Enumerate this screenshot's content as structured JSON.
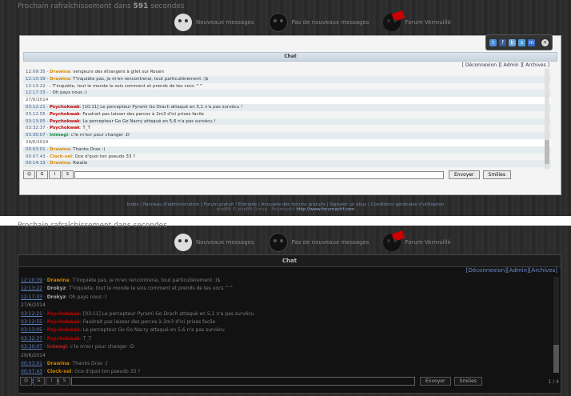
{
  "top": {
    "refresh": {
      "text": "Prochain rafraîchissement dans",
      "seconds": "591",
      "suffix": "secondes"
    },
    "legend": [
      {
        "icon": "white-skull",
        "label": "Nouveaux messages"
      },
      {
        "icon": "dark-skull",
        "label": "Pas de nouveaux messages"
      },
      {
        "icon": "locked-skull",
        "label": "Forum Verrouillé"
      }
    ],
    "chat": {
      "title": "Chat",
      "links": "[ Déconnexion ][ Admin ][ Archives ]",
      "messages": [
        {
          "time": "12:09:35",
          "user": "Drawina",
          "user_color": "#d98a00",
          "text": ": vengeurs des étrangers à gilet sur Rouen"
        },
        {
          "time": "12:10:39",
          "user": "Drawina",
          "user_color": "#d98a00",
          "text": ": T'inquiète pas, je m'en rencontrerai, tout particulièrement :)$"
        },
        {
          "time": "12:13:22",
          "user": "",
          "user_color": "#333",
          "text": ": T'inquiète, tout le monde le sois comment et prends de tes vocs ^^"
        },
        {
          "time": "12:17:33",
          "user": "",
          "user_color": "#333",
          "text": ": Oh pays nous :)"
        },
        {
          "date": "27/6/2014"
        },
        {
          "time": "03:12:21",
          "user": "Psychokwak",
          "user_color": "#b00",
          "text": ": [10:11] Le percepteur Pyrami Go Drach attaqué en 5,1 n'a pas survécu !"
        },
        {
          "time": "03:12:55",
          "user": "Psychokwak",
          "user_color": "#b00",
          "text": ": Faudrait pas laisser des percos à 2m3 d'ici prises facile"
        },
        {
          "time": "03:13:05",
          "user": "Psychokwak",
          "user_color": "#b00",
          "text": ": Le percepteur Go Go Nacry attaqué en 5,6 n'a pas survécu !"
        },
        {
          "time": "03:32:37",
          "user": "Psychokwak",
          "user_color": "#b00",
          "text": ": T_T"
        },
        {
          "time": "03:30:07",
          "user": "Inimegi",
          "user_color": "#1a8c3a",
          "text": ": c'le m'ecr pour changer :D"
        },
        {
          "date": "29/6/2014"
        },
        {
          "time": "00:03:01",
          "user": "Drawina",
          "user_color": "#d98a00",
          "text": ": Thanks Drax :)"
        },
        {
          "time": "00:07:43",
          "user": "Clock-xel",
          "user_color": "#d98a00",
          "text": ": Oce d'quoi ton pseudo 33 ?"
        },
        {
          "time": "00:14:19",
          "user": "Drawina",
          "user_color": "#d98a00",
          "text": ": Rwaile"
        }
      ],
      "send": "Envoyer",
      "smilies": "Smilies",
      "tools": [
        "☺",
        "G",
        "I",
        "S"
      ]
    },
    "footer": {
      "line1": "Index | Panneau d'administration | Forum gratuit ! Entraide | Annuaire des forums gratuits | Signaler un abus | Conditions générales d'utilisation",
      "line2": "phpBB © phpBB Group · Forumactif",
      "link": "http://www.forumactif.com"
    }
  },
  "bottom": {
    "refresh": {
      "text": "Prochain rafraîchissement dans",
      "seconds": "",
      "suffix": "secondes"
    },
    "legend": [
      {
        "icon": "white-skull",
        "label": "Nouveaux messages"
      },
      {
        "icon": "dark-skull",
        "label": "Pas de nouveaux messages"
      },
      {
        "icon": "locked-skull",
        "label": "Forum Verrouillé"
      }
    ],
    "chat": {
      "title": "Chat",
      "links": "[Déconnexion][Admin][Archives]",
      "messages": [
        {
          "time": "12:10:39",
          "user": "Drawina",
          "user_color": "#c88400",
          "text": ": T'inquiète pas, je m'en rencontrerai, tout particulièrement :)$"
        },
        {
          "time": "12:13:22",
          "user": "Drokyz",
          "user_color": "#aaa",
          "text": ": T'inquiète, tout le monde le sois comment et prends de tes vocs ^^"
        },
        {
          "time": "12:17:33",
          "user": "Drokyz",
          "user_color": "#aaa",
          "text": ": Oh pays nous :)"
        },
        {
          "date": "27/6/2014"
        },
        {
          "time": "03:12:21",
          "user": "Psychokwak",
          "user_color": "#b00",
          "text": ": [03:11] Le percepteur Pyrami Go Drach attaqué en 5,1 n'a pas survécu"
        },
        {
          "time": "03:12:55",
          "user": "Psychokwak",
          "user_color": "#b00",
          "text": ": Faudrait pas laisser des percos à 2m3 d'ici prises facile"
        },
        {
          "time": "03:13:05",
          "user": "Psychokwak",
          "user_color": "#b00",
          "text": ": Le percepteur Go Go Nacry attaqué en 5,6 n'a pas survécu"
        },
        {
          "time": "03:32:37",
          "user": "Psychokwak",
          "user_color": "#b00",
          "text": ": T_T"
        },
        {
          "time": "03:30:07",
          "user": "Inimegi",
          "user_color": "#b02020",
          "text": ": c'le m'ecr pour changer :D"
        },
        {
          "date": "29/6/2014"
        },
        {
          "time": "00:03:01",
          "user": "Drawina",
          "user_color": "#c88400",
          "text": ": Thanks Drax :)"
        },
        {
          "time": "00:07:43",
          "user": "Clock-xel",
          "user_color": "#c88400",
          "text": ": Oce d'quoi ton pseudo 33 ?"
        },
        {
          "time": "00:14:19",
          "user": "Drawina",
          "user_color": "#c88400",
          "text": ": Rwaile"
        }
      ],
      "send": "Envoyer",
      "smilies": "Smilies",
      "counter": "1 / 4",
      "tools": [
        "☺",
        "G",
        "I",
        "S"
      ]
    }
  }
}
